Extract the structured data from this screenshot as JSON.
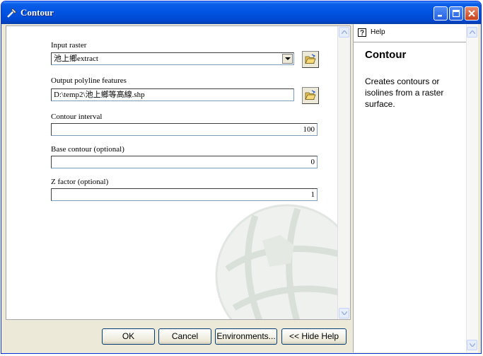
{
  "window": {
    "title": "Contour"
  },
  "form": {
    "input_raster": {
      "label": "Input raster",
      "value": "池上鄉extract"
    },
    "output_polyline": {
      "label": "Output polyline features",
      "value": "D:\\temp2\\池上鄉等高線.shp"
    },
    "contour_interval": {
      "label": "Contour interval",
      "value": "100"
    },
    "base_contour": {
      "label": "Base contour (optional)",
      "value": "0"
    },
    "z_factor": {
      "label": "Z factor (optional)",
      "value": "1"
    }
  },
  "buttons": {
    "ok": "OK",
    "cancel": "Cancel",
    "environments": "Environments...",
    "hide_help": "<< Hide Help"
  },
  "help": {
    "tab_label": "Help",
    "title": "Contour",
    "body": "Creates contours or isolines from a raster surface."
  },
  "colors": {
    "titlebar": "#0054e3",
    "dialog_bg": "#ece9d8",
    "field_border": "#7f9db9"
  },
  "icons": [
    "tool-icon",
    "minimize-icon",
    "maximize-icon",
    "close-icon",
    "dropdown-arrow-icon",
    "open-folder-icon",
    "help-icon",
    "scroll-up-icon",
    "scroll-down-icon",
    "globe-watermark-icon"
  ]
}
